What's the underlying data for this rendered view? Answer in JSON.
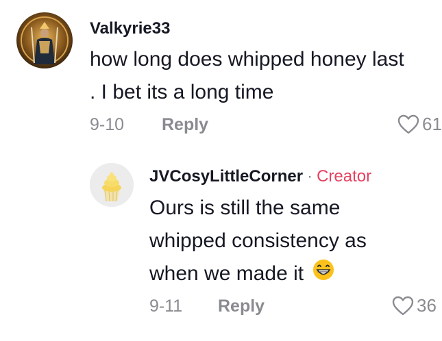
{
  "comments": [
    {
      "username": "Valkyrie33",
      "lines": [
        "how long does whipped honey last",
        ". I bet its a long time"
      ],
      "date": "9-10",
      "reply_label": "Reply",
      "likes": "61"
    },
    {
      "username": "JVCosyLittleCorner",
      "separator": "·",
      "badge": "Creator",
      "lines": [
        "Ours is still the same",
        "whipped consistency as",
        "when we made it"
      ],
      "emoji": "😁",
      "date": "9-11",
      "reply_label": "Reply",
      "likes": "36"
    }
  ],
  "colors": {
    "text": "#161823",
    "muted": "#8a8b91",
    "creator": "#e6405f"
  }
}
